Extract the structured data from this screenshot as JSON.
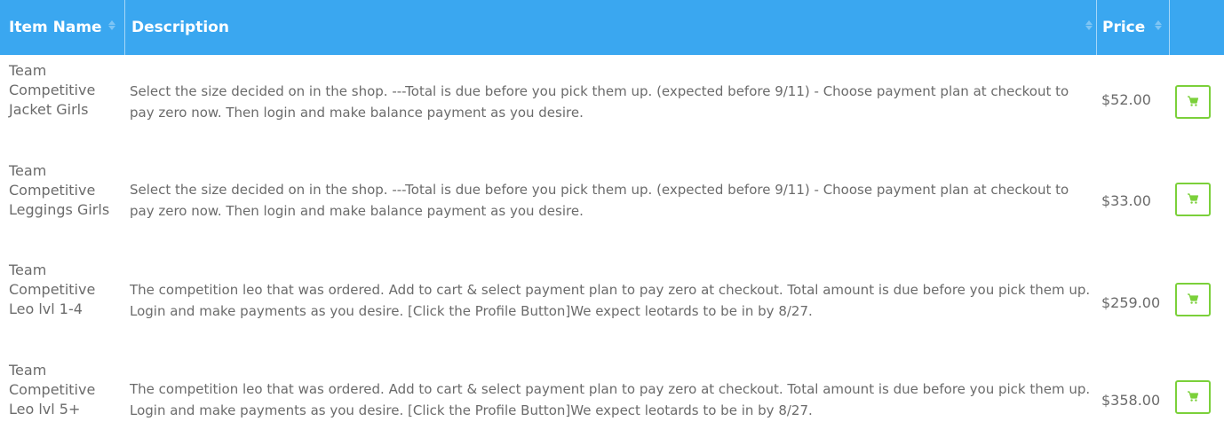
{
  "header": {
    "columns": [
      {
        "label": "Item Name"
      },
      {
        "label": "Description"
      },
      {
        "label": "Price"
      },
      {
        "label": ""
      }
    ]
  },
  "accent_color": "#3aa7f0",
  "cart_button_color": "#7bd03a",
  "cart_icon": "shopping-cart-icon",
  "rows": [
    {
      "name": "Team\nCompetitive\nJacket Girls",
      "description": "Select the size decided on in the shop. ---Total is due before you pick them up. (expected before 9/11) - Choose payment plan at checkout to pay zero now. Then login and make balance payment as you desire.",
      "price": "$52.00"
    },
    {
      "name": "Team\nCompetitive\nLeggings Girls",
      "description": "Select the size decided on in the shop. ---Total is due before you pick them up. (expected before 9/11) - Choose payment plan at checkout to pay zero now. Then login and make balance payment as you desire.",
      "price": "$33.00"
    },
    {
      "name": "Team\nCompetitive\nLeo lvl 1-4",
      "description": "The competition leo that was ordered. Add to cart & select payment plan to pay zero at checkout. Total amount is due before you pick them up. Login and make payments as you desire. [Click the Profile Button]We expect leotards to be in by 8/27.",
      "price": "$259.00"
    },
    {
      "name": "Team\nCompetitive\nLeo lvl 5+",
      "description": "The competition leo that was ordered. Add to cart & select payment plan to pay zero at checkout. Total amount is due before you pick them up. Login and make payments as you desire. [Click the Profile Button]We expect leotards to be in by 8/27.",
      "price": "$358.00"
    }
  ]
}
